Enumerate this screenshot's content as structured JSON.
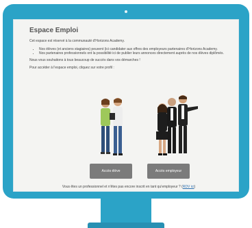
{
  "page": {
    "title": "Espace Emploi",
    "intro": "Cet espace est réservé à la communauté d'Horizons Academy.",
    "bullets": [
      "Nos élèves (et anciens stagiaires) peuvent (ici candidater aux offres des employeurs partenaires d'Horizons Academy.",
      "Nos partenaires professionnels ont la possibilité ici de publier leurs annonces directement auprès de nos élèves diplômés."
    ],
    "wish": "Nous vous souhaitons à tous beaucoup de succès dans vos démarches !",
    "prompt": "Pour accéder à l'espace emploi, cliquez sur votre profil :",
    "btn_student": "Accès élève",
    "btn_employer": "Accès employeur",
    "footer_text": "Vous êtes un professionnel et n'êtes pas encore inscrit en tant qu'employeur ?",
    "footer_link": "RDV ici"
  },
  "colors": {
    "monitor": "#2ba3c7",
    "button": "#7b7b7b",
    "link": "#2b6fb0"
  }
}
